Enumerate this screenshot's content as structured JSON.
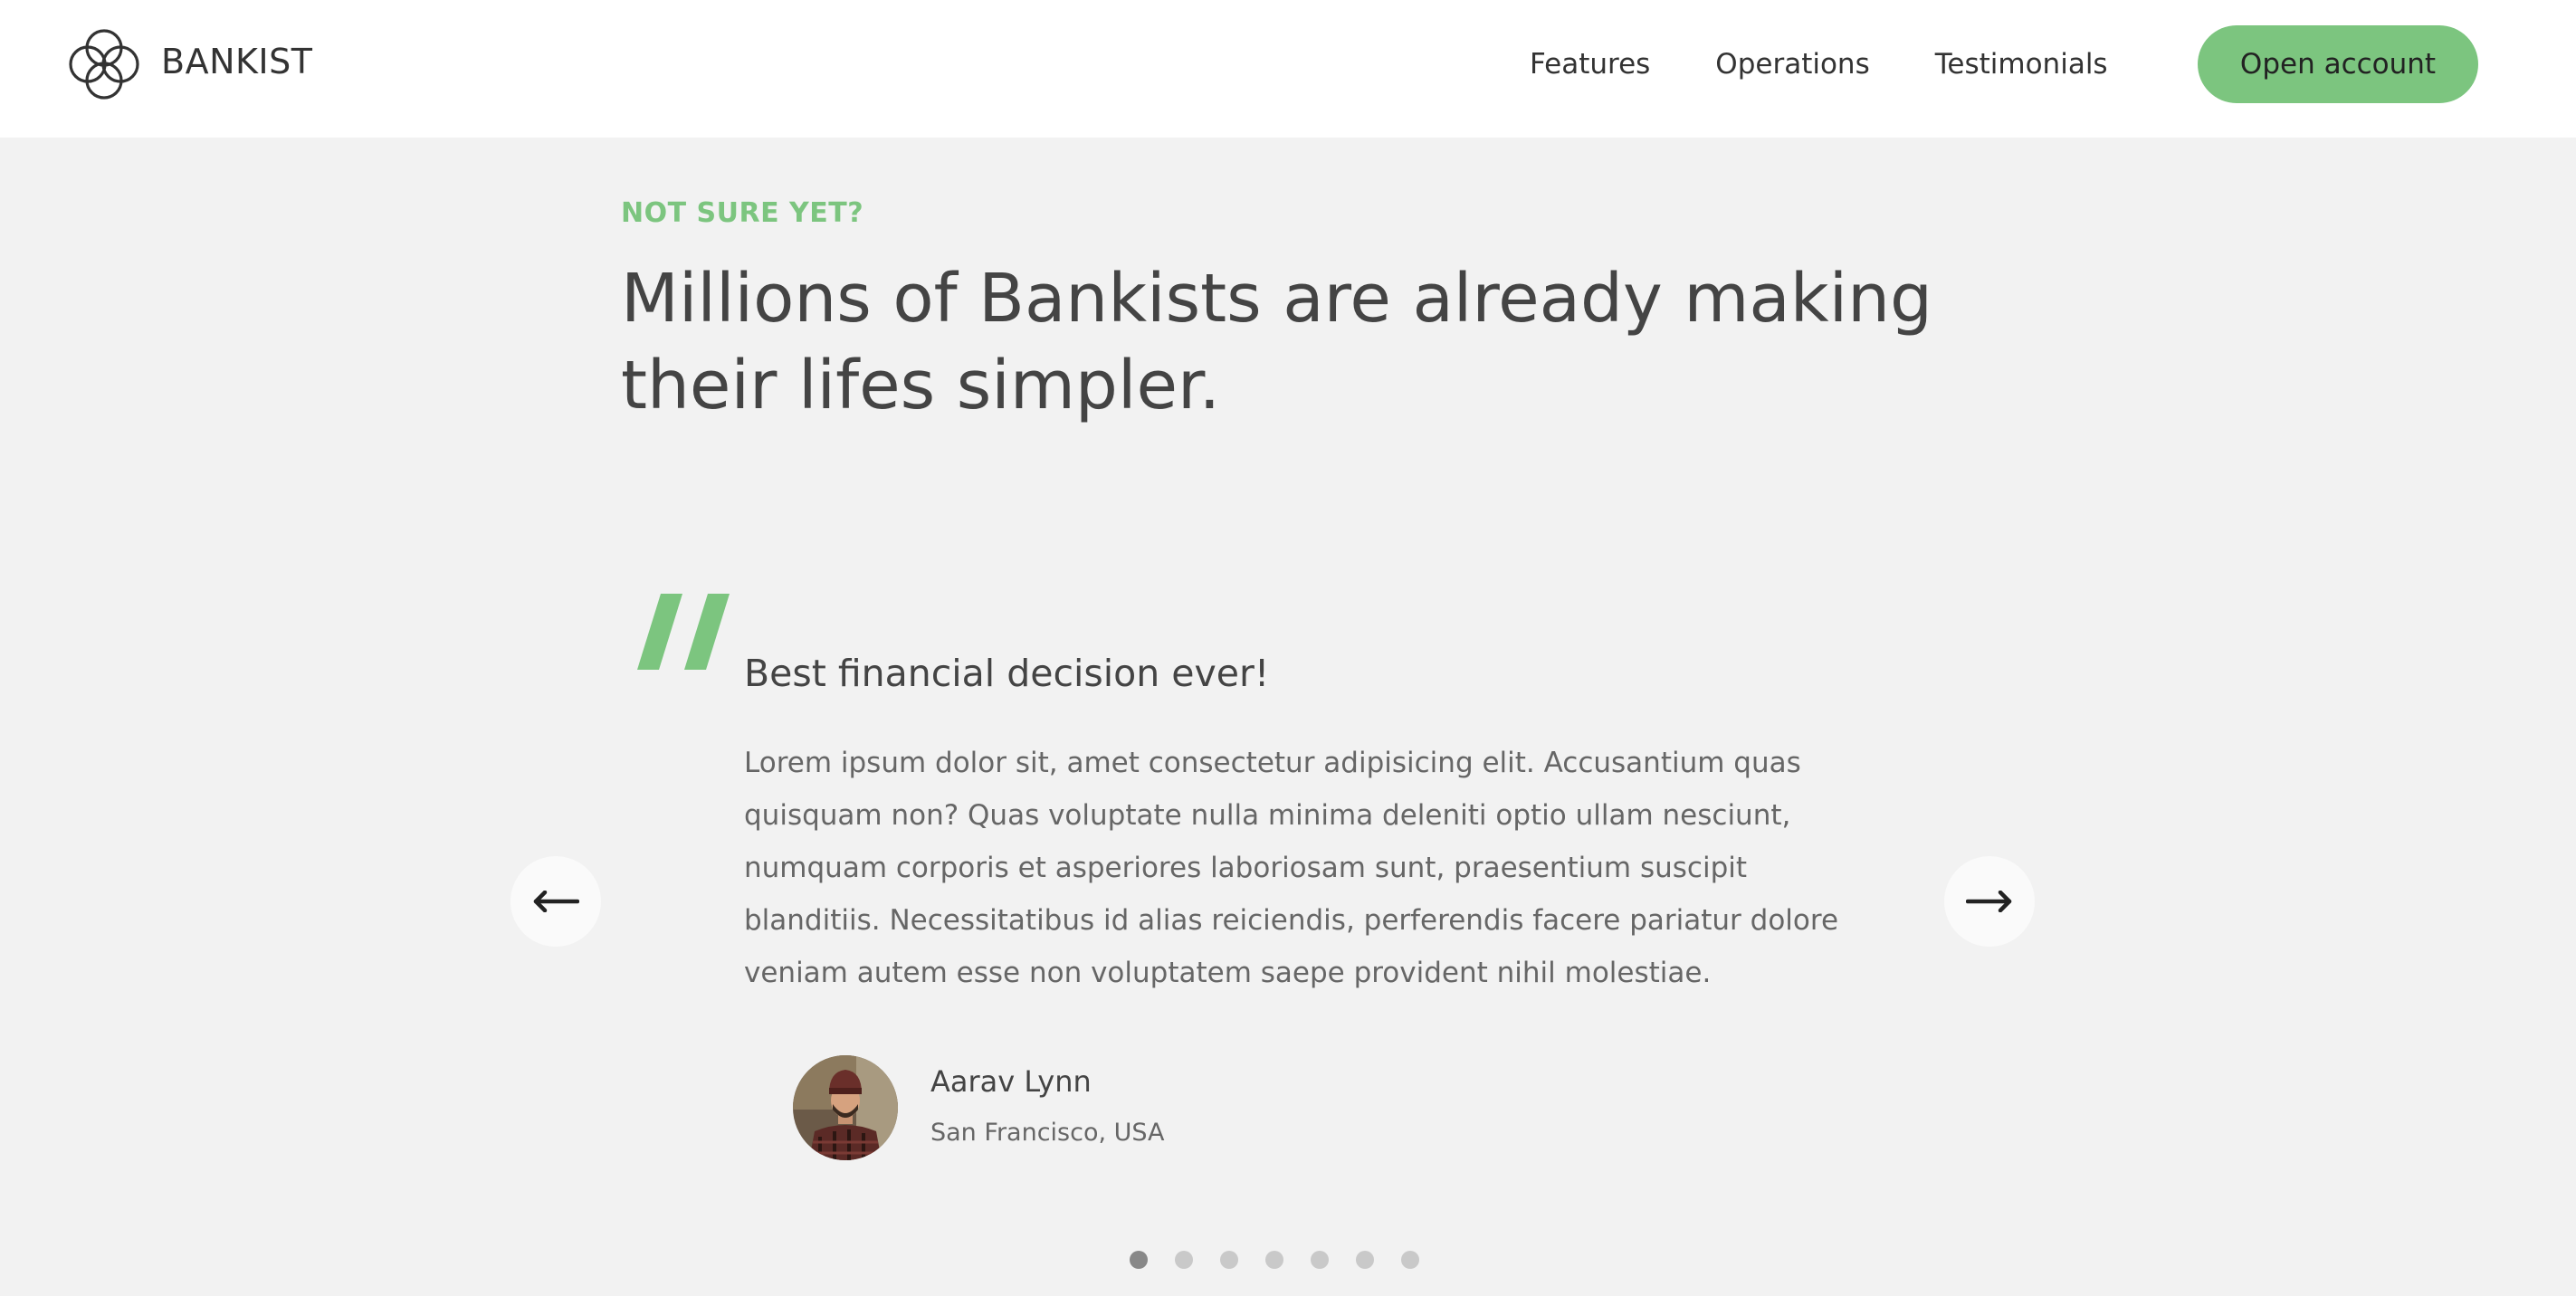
{
  "nav": {
    "brand": "BANKIST",
    "logo_icon": "bankist-rings-logo-icon",
    "links": [
      {
        "label": "Features"
      },
      {
        "label": "Operations"
      },
      {
        "label": "Testimonials"
      }
    ],
    "cta_label": "Open account"
  },
  "section": {
    "eyebrow": "NOT SURE YET?",
    "headline_line1": "Millions of Bankists are already making",
    "headline_line2": "their lifes simpler."
  },
  "testimonial": {
    "quote_icon": "quote-mark-icon",
    "title": "Best financial decision ever!",
    "body": "Lorem ipsum dolor sit, amet consectetur adipisicing elit. Accusantium quas quisquam non? Quas voluptate nulla minima deleniti optio ullam nesciunt, numquam corporis et asperiores laboriosam sunt, praesentium suscipit blanditiis. Necessitatibus id alias reiciendis, perferendis facere pariatur dolore veniam autem esse non voluptatem saepe provident nihil molestiae.",
    "author_name": "Aarav Lynn",
    "author_location": "San Francisco, USA"
  },
  "slider": {
    "prev_icon": "arrow-left-icon",
    "next_icon": "arrow-right-icon",
    "slide_count": 7,
    "active_index": 0
  },
  "colors": {
    "accent": "#7cc57f",
    "background": "#f2f2f2",
    "nav_background": "#ffffff",
    "text": "#444444"
  }
}
